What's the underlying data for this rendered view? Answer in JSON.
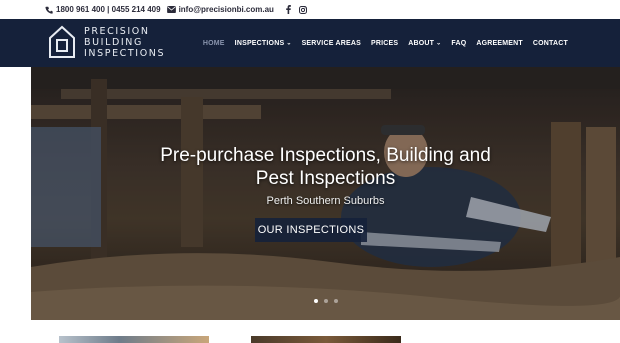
{
  "topbar": {
    "phone": "1800 961 400 | 0455 214 409",
    "email": "info@precisionbi.com.au",
    "icons": [
      "phone-icon",
      "email-icon",
      "facebook-icon",
      "instagram-icon"
    ]
  },
  "brand": {
    "line1": "PRECISION",
    "line2": "BUILDING",
    "line3": "INSPECTIONS"
  },
  "nav": {
    "home": "HOME",
    "inspections": "INSPECTIONS",
    "service_areas": "SERVICE AREAS",
    "prices": "PRICES",
    "about": "ABOUT",
    "faq": "FAQ",
    "agreement": "AGREEMENT",
    "contact": "CONTACT"
  },
  "hero": {
    "title_line1": "Pre-purchase Inspections, Building and",
    "title_line2": "Pest Inspections",
    "subtitle": "Perth Southern Suburbs",
    "button": "OUR INSPECTIONS",
    "slides": 3,
    "active_slide": 1
  },
  "colors": {
    "header_bg": "#15213a",
    "button_bg": "#15213a",
    "nav_active": "#8a95ad",
    "text_light": "#ffffff"
  }
}
